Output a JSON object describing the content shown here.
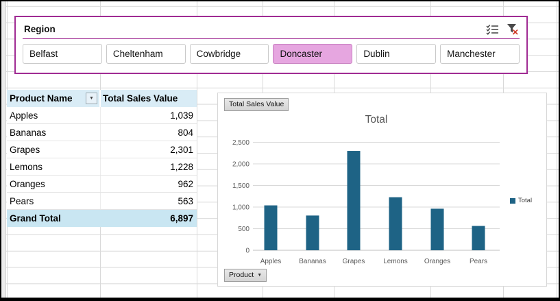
{
  "app": "Excel worksheet with Region slicer, PivotTable and PivotChart",
  "slicer": {
    "title": "Region",
    "accent_color": "#A02B93",
    "selected_fill": "#E6A6E0",
    "multi_select_icon": "multi-select-icon",
    "clear_filter_icon": "clear-filter-icon",
    "items": [
      {
        "label": "Belfast",
        "selected": false
      },
      {
        "label": "Cheltenham",
        "selected": false
      },
      {
        "label": "Cowbridge",
        "selected": false
      },
      {
        "label": "Doncaster",
        "selected": true
      },
      {
        "label": "Dublin",
        "selected": false
      },
      {
        "label": "Manchester",
        "selected": false
      }
    ]
  },
  "pivot_table": {
    "header_fill": "#D9ECF6",
    "grand_total_fill": "#C9E6F2",
    "columns": [
      "Product Name",
      "Total Sales Value"
    ],
    "filter_arrow": "▼",
    "rows": [
      {
        "product": "Apples",
        "value": "1,039"
      },
      {
        "product": "Bananas",
        "value": "804"
      },
      {
        "product": "Grapes",
        "value": "2,301"
      },
      {
        "product": "Lemons",
        "value": "1,228"
      },
      {
        "product": "Oranges",
        "value": "962"
      },
      {
        "product": "Pears",
        "value": "563"
      }
    ],
    "grand_total": {
      "label": "Grand Total",
      "value": "6,897"
    }
  },
  "chart": {
    "value_field_button": "Total Sales Value",
    "axis_field_button": "Product",
    "axis_dropdown_arrow": "▼",
    "legend_label": "Total",
    "title_color": "#595959",
    "axis_label_color": "#595959"
  },
  "chart_data": {
    "type": "bar",
    "title": "Total",
    "categories": [
      "Apples",
      "Bananas",
      "Grapes",
      "Lemons",
      "Oranges",
      "Pears"
    ],
    "values": [
      1039,
      804,
      2301,
      1228,
      962,
      563
    ],
    "series_name": "Total",
    "xlabel": "",
    "ylabel": "",
    "ylim": [
      0,
      2500
    ],
    "ytick_step": 500,
    "ytick_labels": [
      "0",
      "500",
      "1,000",
      "1,500",
      "2,000",
      "2,500"
    ],
    "grid": true,
    "legend_position": "right",
    "bar_color": "#1E6385",
    "gridline_color": "#D9D9D9",
    "axis_line_color": "#BFBFBF"
  }
}
